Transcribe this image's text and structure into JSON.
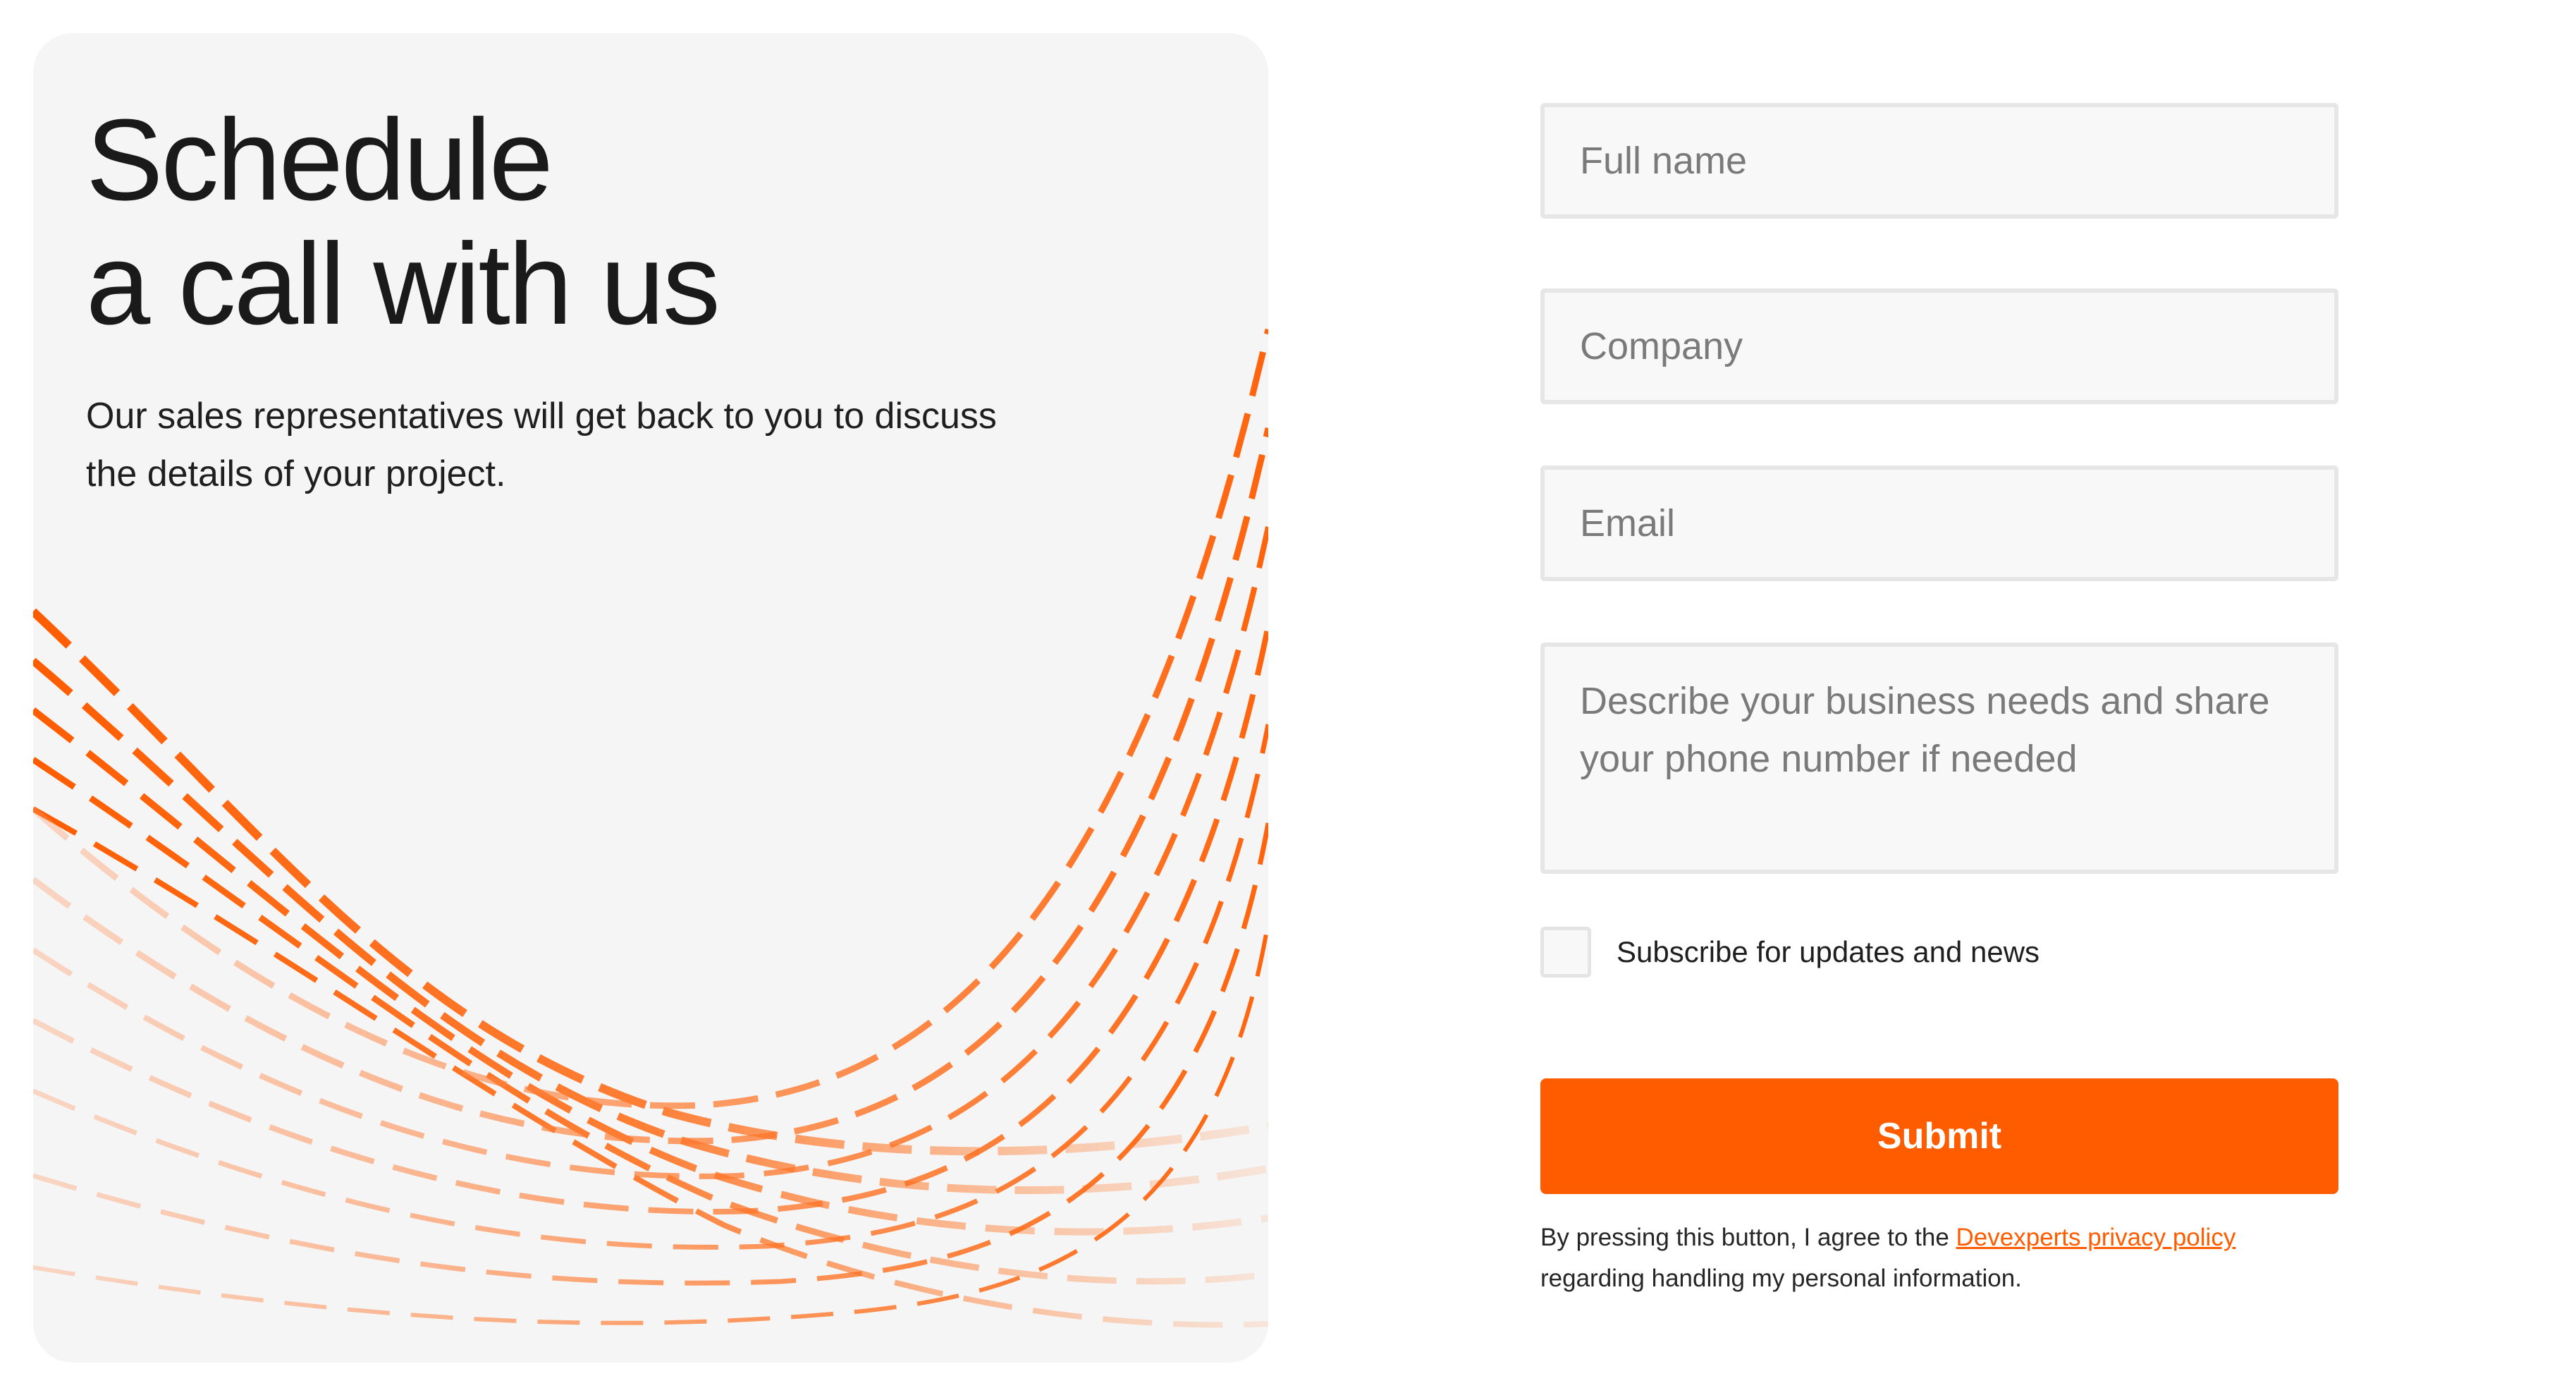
{
  "hero": {
    "title_line1": "Schedule",
    "title_line2": "a call with us",
    "subtitle": "Our sales representatives will get back to you to discuss the details of your project."
  },
  "form": {
    "full_name": {
      "placeholder": "Full name",
      "value": ""
    },
    "company": {
      "placeholder": "Company",
      "value": ""
    },
    "email": {
      "placeholder": "Email",
      "value": ""
    },
    "description": {
      "placeholder": "Describe your business needs and share your phone number if needed",
      "value": ""
    },
    "subscribe": {
      "label": "Subscribe for updates and news",
      "checked": false
    },
    "submit_label": "Submit",
    "legal": {
      "prefix": "By pressing this button, I agree to the ",
      "link_text": "Devexperts privacy policy",
      "suffix": "regarding handling my personal information."
    }
  },
  "colors": {
    "accent": "#ff5c00",
    "card_background": "#f5f5f5",
    "field_background": "#f8f8f8",
    "field_border": "#e6e6e6",
    "text": "#1b1b1b"
  },
  "icons": {
    "decoration": "dashed-wave-lines"
  }
}
